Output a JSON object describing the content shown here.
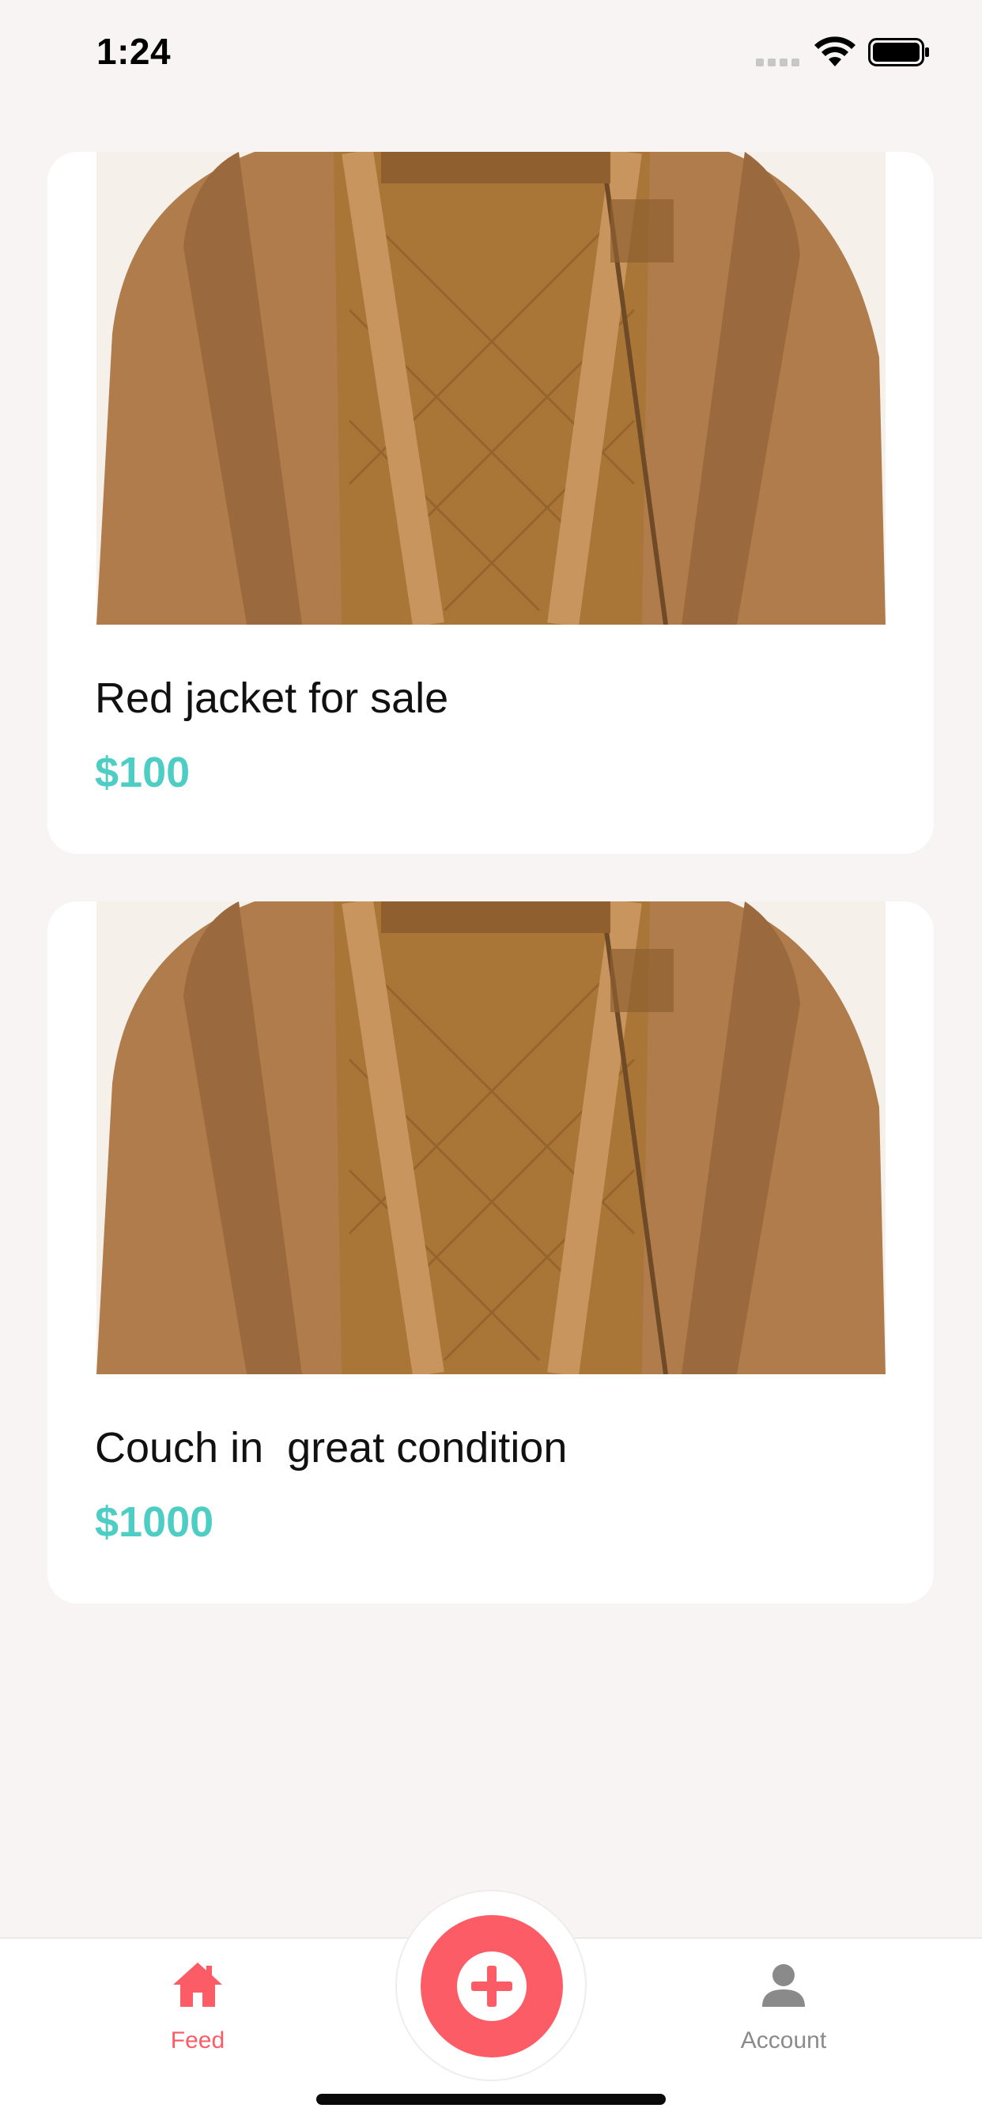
{
  "status_bar": {
    "time": "1:24"
  },
  "listings": [
    {
      "title": "Red jacket for sale",
      "price": "$100",
      "image_icon": "jacket-photo"
    },
    {
      "title": "Couch in  great condition",
      "price": "$1000",
      "image_icon": "jacket-photo"
    }
  ],
  "tab_bar": {
    "feed_label": "Feed",
    "account_label": "Account",
    "add_icon": "plus-circle-icon"
  },
  "colors": {
    "accent": "#fc5c65",
    "price": "#4ecdc4",
    "background": "#f8f4f4"
  }
}
